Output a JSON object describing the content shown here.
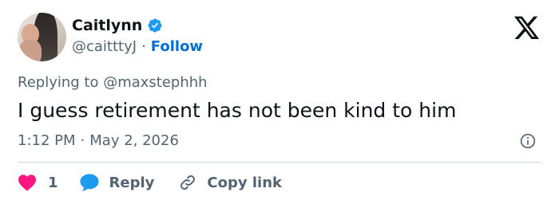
{
  "author": {
    "name": "Caitlynn",
    "handle": "@caitttyJ",
    "separator": "·",
    "follow_label": "Follow"
  },
  "reply_context": "Replying to @maxstephhh",
  "tweet_text": "I guess retirement has not been kind to him",
  "meta": {
    "time": "1:12 PM",
    "separator": "·",
    "date": "May 2, 2026"
  },
  "actions": {
    "like_count": "1",
    "reply_label": "Reply",
    "copy_label": "Copy link"
  },
  "icons": {
    "verified": "verified-badge-icon",
    "logo": "x-logo-icon",
    "info": "info-icon",
    "like": "heart-icon",
    "reply": "speech-bubble-icon",
    "copy": "link-icon"
  },
  "colors": {
    "accent": "#006fd6",
    "verified": "#1d9bf0",
    "like": "#f91880",
    "text_secondary": "#536471",
    "text_primary": "#0f1419"
  }
}
